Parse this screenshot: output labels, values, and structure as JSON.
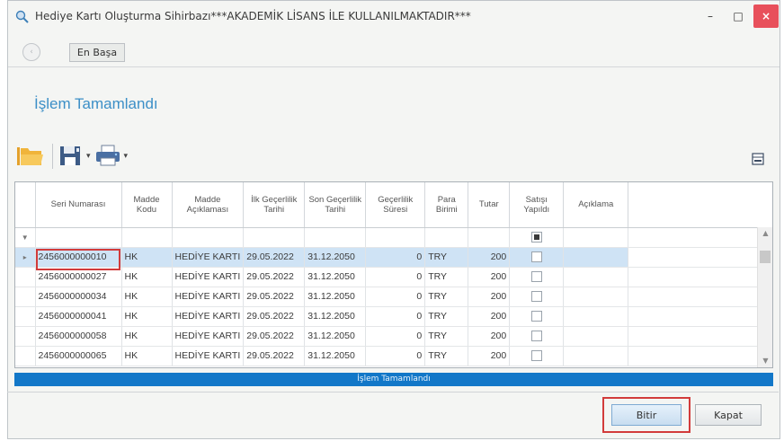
{
  "window": {
    "title": "Hediye Kartı Oluşturma Sihirbazı***AKADEMİK LİSANS İLE KULLANILMAKTADIR***",
    "minimize": "–",
    "maximize": "□",
    "close": "×"
  },
  "nav": {
    "back": "‹",
    "home_label": "En Başa"
  },
  "page": {
    "title": "İşlem Tamamlandı"
  },
  "toolbar": {
    "open_icon": "folder-open-icon",
    "save_icon": "save-icon",
    "print_icon": "printer-icon",
    "layout_icon": "grid-layout-icon",
    "dropdown": "▾"
  },
  "grid": {
    "columns": [
      "Seri Numarası",
      "Madde Kodu",
      "Madde Açıklaması",
      "İlk Geçerlilik Tarihi",
      "Son Geçerlilik Tarihi",
      "Geçerlilik Süresi",
      "Para Birimi",
      "Tutar",
      "Satışı Yapıldı",
      "Açıklama"
    ],
    "filter_marker": "▼",
    "current_row_marker": "▸",
    "rows": [
      {
        "seri": "2456000000010",
        "kod": "HK",
        "aciklama": "HEDİYE KARTI",
        "ilk": "29.05.2022",
        "son": "31.12.2050",
        "sure": "0",
        "para": "TRY",
        "tutar": "200",
        "satis": false,
        "not": ""
      },
      {
        "seri": "2456000000027",
        "kod": "HK",
        "aciklama": "HEDİYE KARTI",
        "ilk": "29.05.2022",
        "son": "31.12.2050",
        "sure": "0",
        "para": "TRY",
        "tutar": "200",
        "satis": false,
        "not": ""
      },
      {
        "seri": "2456000000034",
        "kod": "HK",
        "aciklama": "HEDİYE KARTI",
        "ilk": "29.05.2022",
        "son": "31.12.2050",
        "sure": "0",
        "para": "TRY",
        "tutar": "200",
        "satis": false,
        "not": ""
      },
      {
        "seri": "2456000000041",
        "kod": "HK",
        "aciklama": "HEDİYE KARTI",
        "ilk": "29.05.2022",
        "son": "31.12.2050",
        "sure": "0",
        "para": "TRY",
        "tutar": "200",
        "satis": false,
        "not": ""
      },
      {
        "seri": "2456000000058",
        "kod": "HK",
        "aciklama": "HEDİYE KARTI",
        "ilk": "29.05.2022",
        "son": "31.12.2050",
        "sure": "0",
        "para": "TRY",
        "tutar": "200",
        "satis": false,
        "not": ""
      },
      {
        "seri": "2456000000065",
        "kod": "HK",
        "aciklama": "HEDİYE KARTI",
        "ilk": "29.05.2022",
        "son": "31.12.2050",
        "sure": "0",
        "para": "TRY",
        "tutar": "200",
        "satis": false,
        "not": ""
      }
    ],
    "scroll_up": "▲",
    "scroll_down": "▼"
  },
  "status": {
    "text": "İşlem Tamamlandı"
  },
  "buttons": {
    "finish": "Bitir",
    "close": "Kapat"
  },
  "colors": {
    "accent": "#3c8fc7",
    "statusbar": "#1277c8",
    "selected_row": "#cfe3f5",
    "highlight": "#d23b3b"
  }
}
